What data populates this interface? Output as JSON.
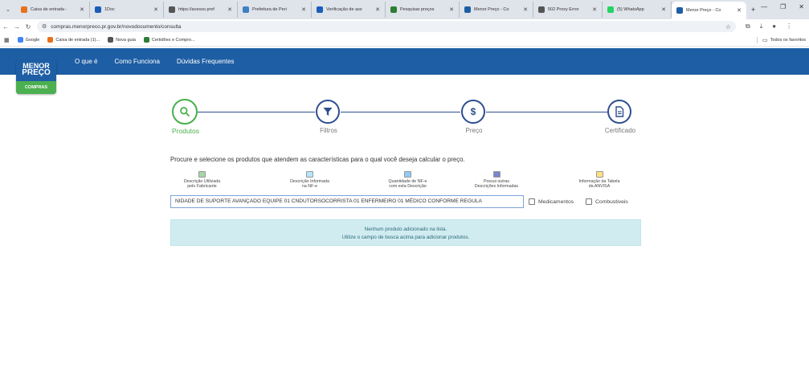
{
  "browser": {
    "tabs": [
      {
        "label": "Caixa de entrada -",
        "color": "#e8711b"
      },
      {
        "label": "1Doc",
        "color": "#1b5db8"
      },
      {
        "label": "https://acesso.pref",
        "color": "#555555"
      },
      {
        "label": "Prefeitura de Peri",
        "color": "#3b82c4"
      },
      {
        "label": "Verificação de ass",
        "color": "#1b5db8"
      },
      {
        "label": "Pesquisar preços",
        "color": "#2e7d32"
      },
      {
        "label": "Menor Preço - Co",
        "color": "#1e5ea4"
      },
      {
        "label": "502 Proxy Error",
        "color": "#555555"
      },
      {
        "label": "(5) WhatsApp",
        "color": "#25d366"
      },
      {
        "label": "Menor Preço - Co",
        "color": "#1e5ea4"
      }
    ],
    "address": "compras.menorpreco.pr.gov.br/novodocumento/consulta",
    "bookmarks": [
      {
        "label": "Google",
        "color": "#4285f4"
      },
      {
        "label": "Caixa de entrada (1)...",
        "color": "#e8711b"
      },
      {
        "label": "Nova guia",
        "color": "#555555"
      },
      {
        "label": "Certidões e Compro...",
        "color": "#2e7d32"
      }
    ],
    "all_bookmarks": "Todos os favoritos"
  },
  "site": {
    "logo_line1": "MENOR",
    "logo_line2": "PREÇO",
    "logo_band": "COMPRAS",
    "nav": [
      "O que é",
      "Como Funciona",
      "Dúvidas Frequentes"
    ]
  },
  "steps": [
    {
      "label": "Produtos",
      "icon": "search-icon",
      "active": true
    },
    {
      "label": "Filtros",
      "icon": "filter-icon",
      "active": false
    },
    {
      "label": "Preço",
      "icon": "dollar-icon",
      "active": false
    },
    {
      "label": "Certificado",
      "icon": "document-icon",
      "active": false
    }
  ],
  "instructions": "Procure e selecione os produtos que atendem as características para o qual você deseja calcular o preço.",
  "legend": [
    {
      "line1": "Descrição Utilizada",
      "line2": "pelo Fabricante",
      "color": "#a5d6a7"
    },
    {
      "line1": "Descrição Informada",
      "line2": "na NF-e",
      "color": "#b3e5fc"
    },
    {
      "line1": "Quantidade de NF-e",
      "line2": "com esta Descrição",
      "color": "#90caf9"
    },
    {
      "line1": "Possui outras",
      "line2": "Descrições Informadas",
      "color": "#7986cb"
    },
    {
      "line1": "Informação da Tabela",
      "line2": "da ANVISA",
      "color": "#ffe082"
    }
  ],
  "search": {
    "value": "NIDADE DE SUPORTE AVANÇADO  EQUIPE 01 CNDUTORSOCORRISTA 01 ENFERMEIRO 01 MÉDICO CONFORME REGULA"
  },
  "filters": {
    "medicamentos": "Medicamentos",
    "combustiveis": "Combustiveis"
  },
  "empty": {
    "line1": "Nenhum produto adicionado na lista.",
    "line2": "Utilize o campo de busca acima para adicionar produtos."
  }
}
